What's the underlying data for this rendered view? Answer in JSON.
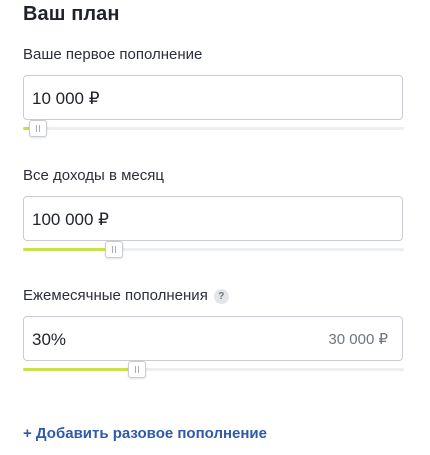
{
  "plan": {
    "title": "Ваш план"
  },
  "fields": [
    {
      "label": "Ваше первое пополнение",
      "value": "10 000 ₽",
      "slider_fraction": 0.04
    },
    {
      "label": "Все доходы в месяц",
      "value": "100 000 ₽",
      "slider_fraction": 0.24
    },
    {
      "label": "Ежемесячные пополнения",
      "help_icon": "question-icon",
      "help_glyph": "?",
      "value": "30%",
      "secondary_value": "30 000 ₽",
      "slider_fraction": 0.3
    }
  ],
  "add_link": {
    "label": "+ Добавить разовое пополнение"
  },
  "colors": {
    "slider_fill": "#c7e24b",
    "link": "#2e5aa8"
  }
}
